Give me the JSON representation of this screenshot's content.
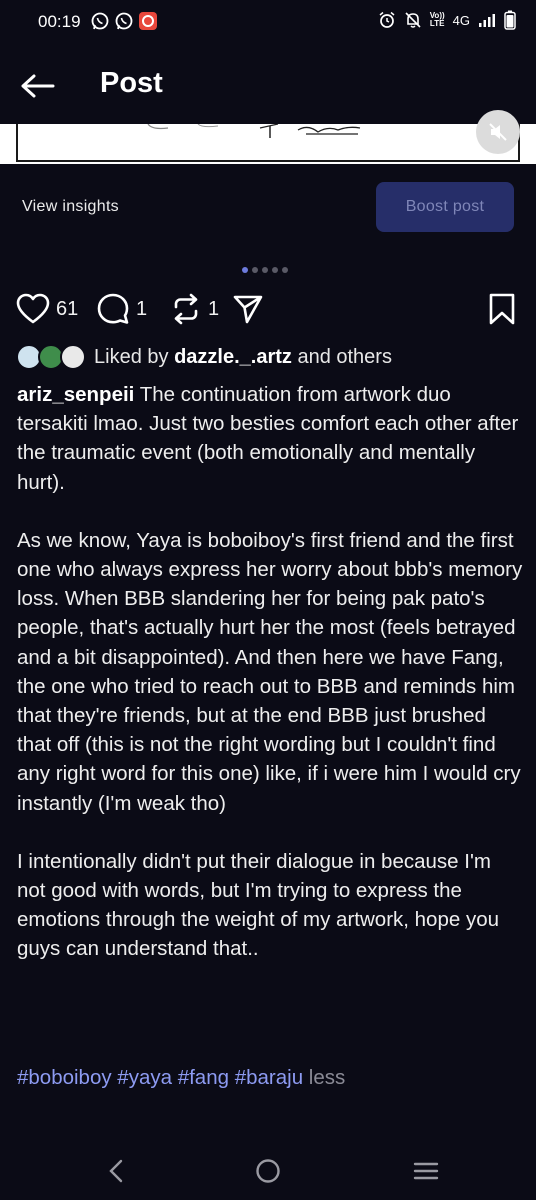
{
  "status_bar": {
    "time": "00:19",
    "network_top": "VoLTE",
    "network_badge_line1": "Vo))",
    "network_badge_line2": "LTE",
    "network_type": "4G"
  },
  "header": {
    "title": "Post"
  },
  "insights": {
    "view_label": "View insights",
    "boost_label": "Boost post"
  },
  "carousel": {
    "count": 5,
    "active_index": 0
  },
  "actions": {
    "likes": "61",
    "comments": "1",
    "reposts": "1"
  },
  "liked_by": {
    "prefix": "Liked by ",
    "user": "dazzle._.artz",
    "suffix": " and others"
  },
  "caption": {
    "username": "ariz_senpeii",
    "paragraph1": " The continuation from artwork duo tersakiti lmao. Just two besties comfort each other after the traumatic event (both emotionally and mentally hurt).",
    "paragraph2": "As we know, Yaya is boboiboy's first friend and the first one who always express her worry about bbb's memory loss. When BBB slandering her for being pak pato's people, that's actually hurt her the most (feels betrayed and a bit disappointed). And then here we have Fang, the one who tried to reach out to BBB and reminds him that they're friends, but at the end BBB just brushed that off (this is not the right wording but I couldn't find any right word for this one) like, if i were him I would cry instantly (I'm weak tho)",
    "paragraph3": "I intentionally didn't put their dialogue in because I'm not good with words, but I'm trying to express the emotions through the weight of my artwork, hope you guys can understand that..",
    "hashtags": "#boboiboy #yaya #fang #baraju",
    "less_label": " less"
  },
  "colors": {
    "background": "#0b0b16",
    "boost_bg": "#262e69",
    "hashtag": "#8d9bf2",
    "active_dot": "#6d7bdc"
  },
  "icons": [
    "back-arrow-icon",
    "heart-icon",
    "comment-icon",
    "repost-icon",
    "share-icon",
    "bookmark-icon",
    "mute-icon",
    "whatsapp-icon",
    "alarm-icon",
    "muted-bell-icon",
    "signal-icon",
    "battery-icon"
  ]
}
